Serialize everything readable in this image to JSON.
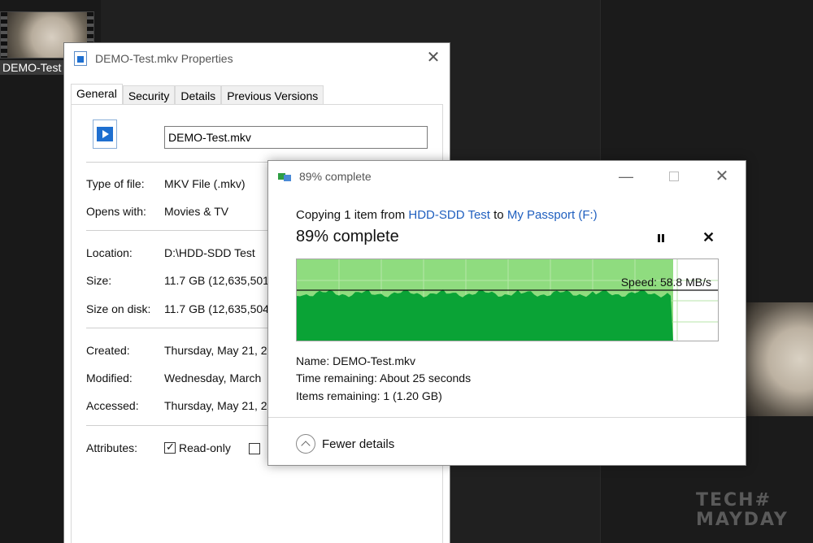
{
  "desktop": {
    "thumb_label": "DEMO-Test",
    "watermark_top": "TECH#",
    "watermark_bottom": "MAYDAY"
  },
  "properties": {
    "title": "DEMO-Test.mkv Properties",
    "tabs": [
      {
        "label": "General"
      },
      {
        "label": "Security"
      },
      {
        "label": "Details"
      },
      {
        "label": "Previous Versions"
      }
    ],
    "filename": "DEMO-Test.mkv",
    "rows": [
      {
        "key": "Type of file:",
        "value": "MKV File (.mkv)"
      },
      {
        "key": "Opens with:",
        "value": "Movies & TV"
      },
      {
        "key": "Location:",
        "value": "D:\\HDD-SDD Test"
      },
      {
        "key": "Size:",
        "value": "11.7 GB (12,635,501"
      },
      {
        "key": "Size on disk:",
        "value": "11.7 GB (12,635,504"
      },
      {
        "key": "Created:",
        "value": "Thursday, May 21, 2"
      },
      {
        "key": "Modified:",
        "value": "Wednesday, March"
      },
      {
        "key": "Accessed:",
        "value": "Thursday, May 21, 2"
      }
    ],
    "attributes_label": "Attributes:",
    "readonly_label": "Read-only"
  },
  "copy": {
    "title": "89% complete",
    "copying_prefix": "Copying 1 item from ",
    "source": "HDD-SDD Test",
    "to_word": " to ",
    "destination": "My Passport (F:)",
    "percent_label": "89% complete",
    "percent": 89,
    "speed_label": "Speed: 58.8 MB/s",
    "name_label": "Name:",
    "name_value": "DEMO-Test.mkv",
    "time_label": "Time remaining:",
    "time_value": "About 25 seconds",
    "items_label": "Items remaining:",
    "items_value": "1 (1.20 GB)",
    "fewer_details": "Fewer details"
  },
  "colors": {
    "progress_fill": "#8fdc7f",
    "speed_fill": "#0aa336",
    "link": "#1f5fbf"
  }
}
